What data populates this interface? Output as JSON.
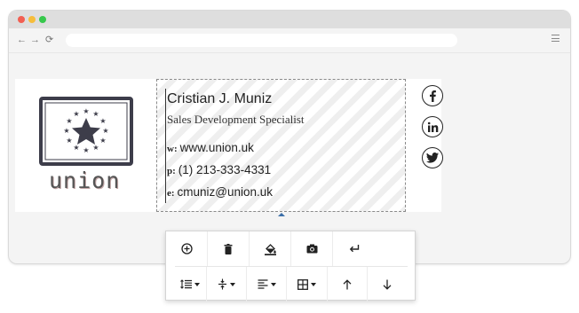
{
  "browser": {
    "nav": {
      "back": "←",
      "forward": "→",
      "reload": "⟳"
    },
    "url": ""
  },
  "signature": {
    "logo_text": "union",
    "name": "Cristian J. Muniz",
    "title": "Sales Development Specialist",
    "contacts": [
      {
        "label": "w:",
        "value": "www.union.uk"
      },
      {
        "label": "p:",
        "value": "(1) 213-333-4331"
      },
      {
        "label": "e:",
        "value": "cmuniz@union.uk"
      }
    ],
    "social_icons": [
      "facebook-icon",
      "linkedin-icon",
      "twitter-icon"
    ]
  },
  "toolbar": {
    "row1": [
      "add-icon",
      "trash-icon",
      "fill-color-icon",
      "camera-icon",
      "enter-icon"
    ],
    "row2": [
      "line-height-icon",
      "spacing-icon",
      "align-left-icon",
      "table-icon",
      "arrow-up-icon",
      "arrow-down-icon"
    ]
  },
  "colors": {
    "accent": "#3b6ea8",
    "logo_flag": "#3d3d4a"
  }
}
